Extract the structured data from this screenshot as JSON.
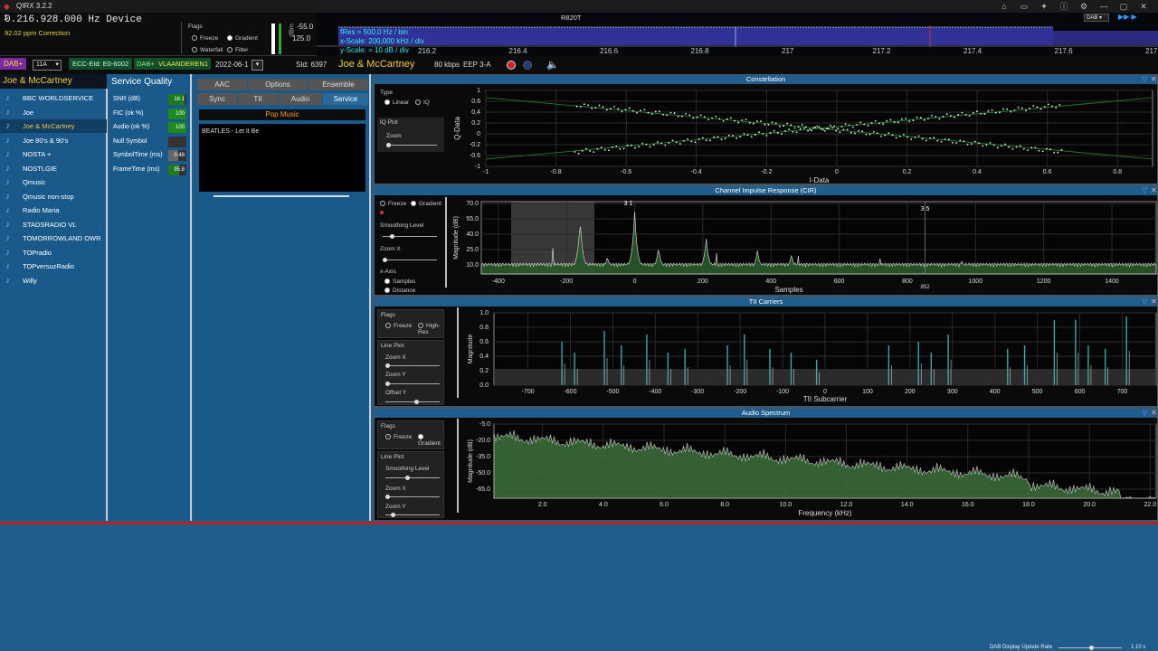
{
  "app": {
    "title": "QIRX 3.2.2",
    "device_title": "R820T"
  },
  "top": {
    "frequency": "0.216.928.000 Hz Device",
    "ppm": "92.02 ppm Correction",
    "flags_label": "Flags",
    "freeze": "Freeze",
    "gradient": "Gradient",
    "waterfall": "Waterfall",
    "filter": "Filter",
    "level_top": "-55.0",
    "level_bottom": "125.0",
    "fres": "fRes = 500,0 Hz / bin",
    "xscale": "x-Scale: 200,000 kHz / div",
    "yscale": "y-Scale: = 10 dB / div",
    "band_select": "DAB",
    "freq_ticks": [
      "216.2",
      "216.4",
      "216.6",
      "216.8",
      "217",
      "217.2",
      "217.4",
      "217.6",
      "217.8"
    ]
  },
  "infobar": {
    "dab_plus": "DAB+",
    "channel": "11A",
    "ecc": "ECC-EId: E0-6002",
    "dab_plus2": "DAB+",
    "ensemble": "VLAANDEREN1",
    "date": "2022-06-1",
    "sid": "SId: 6397",
    "service_name": "Joe & McCartney",
    "bitrate": "80 kbps",
    "eep": "EEP 3-A"
  },
  "services": {
    "title": "Joe & McCartney",
    "items": [
      "BBC WORLDSERVICE",
      "Joe",
      "Joe & McCartney",
      "Joe 80's & 90's",
      "NOSTA +",
      "NOSTLGIE",
      "Qmusic",
      "Qmusic non-stop",
      "Radio Maria",
      "STADSRADIO VL",
      "TOMORROWLAND OWR",
      "TOPradio",
      "TOPversuzRadio",
      "Willy"
    ],
    "selected_index": 2
  },
  "quality": {
    "title": "Service Quality",
    "rows": [
      {
        "label": "SNR (dB)",
        "value": "18.1",
        "level": 0.9,
        "color": "#1e7a1e"
      },
      {
        "label": "FIC (ok %)",
        "value": "100",
        "level": 1,
        "color": "#1e8a1e"
      },
      {
        "label": "Audio (ok %)",
        "value": "100",
        "level": 1,
        "color": "#1e8a1e"
      },
      {
        "label": "Null Symbol",
        "value": "",
        "level": 0,
        "color": "#333"
      },
      {
        "label": "SymbolTime (ms)",
        "value": "0.48",
        "level": 0.55,
        "color": "#666"
      },
      {
        "label": "FrameTime (ms)",
        "value": "95.8",
        "level": 0.6,
        "color": "#1e7a1e"
      }
    ]
  },
  "tabs": {
    "row1": [
      "AAC",
      "Options",
      "Ensemble"
    ],
    "row2": [
      "Sync",
      "TII",
      "Audio",
      "Service"
    ],
    "genre": "Pop Music",
    "dls": "BEATLES - Let It Be"
  },
  "constellation": {
    "title": "Constellation",
    "type_label": "Type",
    "linear": "Linear",
    "iq": "IQ",
    "iq_plot": "IQ Plot",
    "zoom": "Zoom",
    "xlabel": "I-Data",
    "ylabel": "Q-Data",
    "xticks": [
      "-1",
      "-0.8",
      "-0.6",
      "-0.4",
      "-0.2",
      "0",
      "0.2",
      "0.4",
      "0.6",
      "0.8"
    ],
    "yticks": [
      "1",
      "0.6",
      "0.4",
      "0.2",
      "0",
      "-0.2",
      "-0.6",
      "-1"
    ]
  },
  "cir": {
    "title": "Channel Impulse Response (CIR)",
    "freeze": "Freeze",
    "gradient": "Gradient",
    "smoothing": "Smoothing Level",
    "zoomx": "Zoom X",
    "xaxis": "x-Axis",
    "samples": "Samples",
    "distance": "Distance",
    "xlabel": "Samples",
    "ylabel": "Magnitude (dB)",
    "yticks": [
      "70.0",
      "55.0",
      "40.0",
      "25.0",
      "10.0"
    ],
    "xticks": [
      "-400",
      "-200",
      "0",
      "200",
      "400",
      "600",
      "800",
      "1000",
      "1200",
      "1400"
    ],
    "marker1": "3 1",
    "marker2": "3 5",
    "marker_val": "852"
  },
  "tii": {
    "title": "TII Carriers",
    "flags": "Flags",
    "freeze": "Freeze",
    "highres": "High-Res",
    "lineplot": "Line Plot",
    "zoomx": "Zoom X",
    "zoomy": "Zoom Y",
    "offsety": "Offset Y",
    "xlabel": "TII Subcarrier",
    "ylabel": "Magnitude",
    "yticks": [
      "1.0",
      "0.8",
      "0.6",
      "0.4",
      "0.2",
      "0.0"
    ],
    "xticks": [
      "-700",
      "-600",
      "-500",
      "-400",
      "-300",
      "-200",
      "-100",
      "0",
      "100",
      "200",
      "300",
      "400",
      "500",
      "600",
      "700"
    ]
  },
  "audio": {
    "title": "Audio Spectrum",
    "flags": "Flags",
    "freeze": "Freeze",
    "gradient": "Gradient",
    "lineplot": "Line Plot",
    "smoothing": "Smoothing Level",
    "zoomx": "Zoom X",
    "zoomy": "Zoom Y",
    "xlabel": "Frequency (kHz)",
    "ylabel": "Magnitude (dB)",
    "yticks": [
      "-5.0",
      "-20.0",
      "-35.0",
      "-50.0",
      "-65.0"
    ],
    "xticks": [
      "2.0",
      "4.0",
      "6.0",
      "8.0",
      "10.0",
      "12.0",
      "14.0",
      "16.0",
      "18.0",
      "20.0",
      "22.0"
    ]
  },
  "status": {
    "update_rate": "DAB Display Update Rate",
    "rate_value": "1.10 s"
  }
}
